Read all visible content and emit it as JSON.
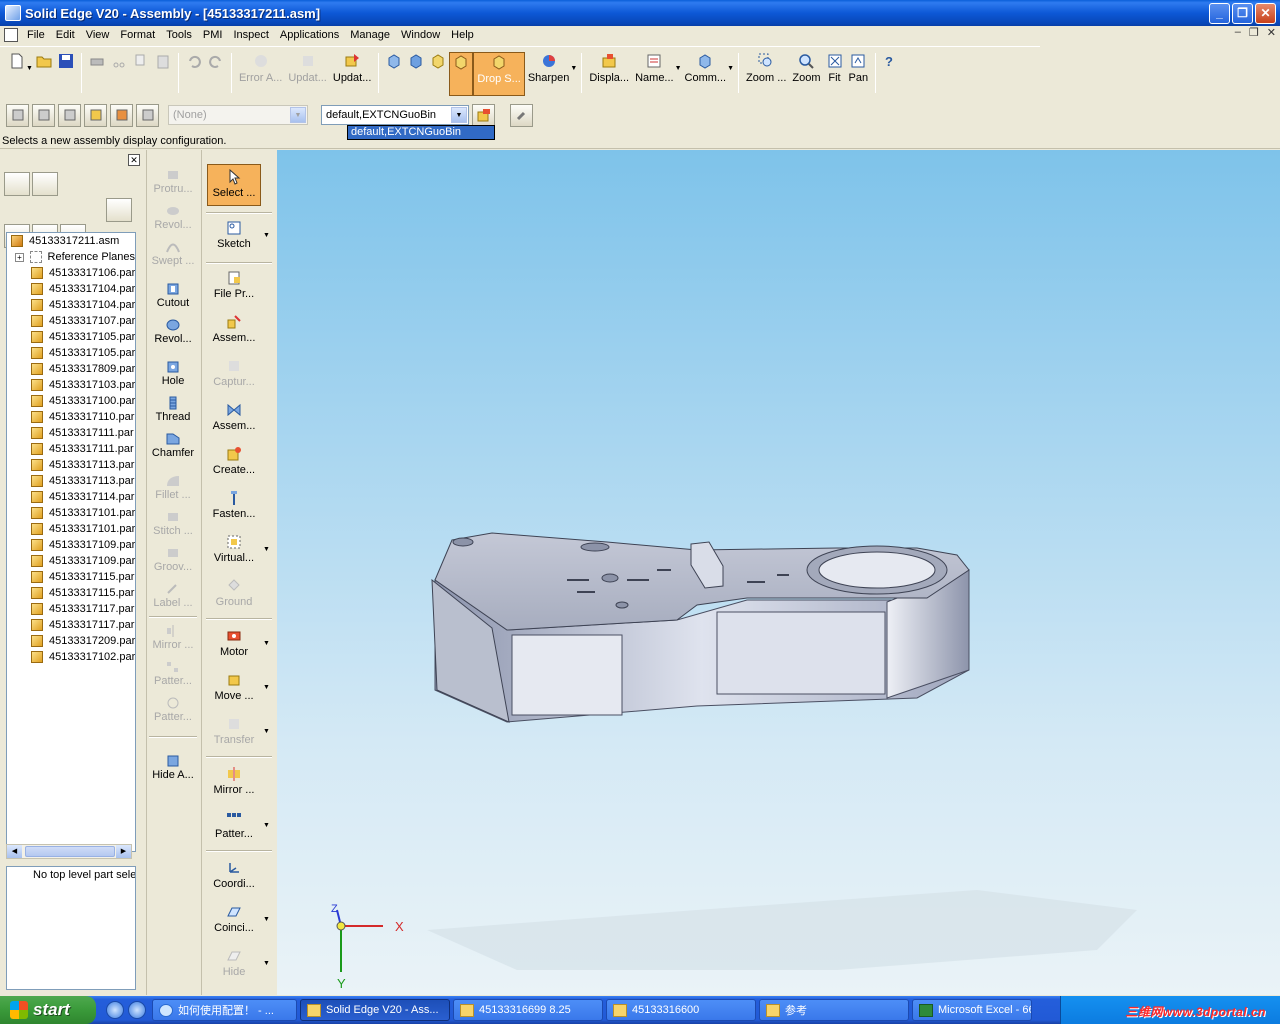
{
  "window": {
    "title": "Solid Edge V20 - Assembly - [45133317211.asm]"
  },
  "menu": [
    "File",
    "Edit",
    "View",
    "Format",
    "Tools",
    "PMI",
    "Inspect",
    "Applications",
    "Manage",
    "Window",
    "Help"
  ],
  "ribbon": {
    "error_assistant": "Error A...",
    "update_disabled": "Updat...",
    "update": "Updat...",
    "drop_shading": "Drop S...",
    "sharpen": "Sharpen",
    "display": "Displa...",
    "named_views": "Name...",
    "common_views": "Comm...",
    "zoom_area": "Zoom ...",
    "zoom": "Zoom",
    "fit": "Fit",
    "pan": "Pan"
  },
  "toolbar2": {
    "config_none": "(None)",
    "display_config": "default,EXTCNGuoBin",
    "dropdown_selected": "default,EXTCNGuoBin"
  },
  "prompt": "Selects a new assembly display configuration.",
  "tree": {
    "root": "45133317211.asm",
    "reference_planes": "Reference Planes",
    "parts": [
      "45133317106.par",
      "45133317104.par",
      "45133317104.par",
      "45133317107.par",
      "45133317105.par",
      "45133317105.par",
      "45133317809.par",
      "45133317103.par",
      "45133317100.par",
      "45133317110.par",
      "45133317111.par",
      "45133317111.par",
      "45133317113.par",
      "45133317113.par",
      "45133317114.par",
      "45133317101.par",
      "45133317101.par",
      "45133317109.par",
      "45133317109.par",
      "45133317115.par",
      "45133317115.par",
      "45133317117.par",
      "45133317117.par",
      "45133317209.par",
      "45133317102.par"
    ],
    "info": "No top level part selected"
  },
  "features": {
    "protrusion": "Protru...",
    "revolved_disabled": "Revol...",
    "swept": "Swept ...",
    "cutout": "Cutout",
    "revolved_cut": "Revol...",
    "hole": "Hole",
    "thread": "Thread",
    "chamfer": "Chamfer",
    "fillet": "Fillet ...",
    "stitch": "Stitch ...",
    "groove": "Groov...",
    "label": "Label ...",
    "mirror": "Mirror ...",
    "pattern1": "Patter...",
    "pattern2": "Patter...",
    "hide_all": "Hide A..."
  },
  "assembly_cmds": {
    "select": "Select ...",
    "sketch": "Sketch",
    "file_properties": "File Pr...",
    "assemble": "Assem...",
    "capture": "Captur...",
    "assembly_relationships": "Assem...",
    "create": "Create...",
    "fastener": "Fasten...",
    "virtual": "Virtual...",
    "ground": "Ground",
    "motor": "Motor",
    "move": "Move ...",
    "transfer": "Transfer",
    "mirror": "Mirror ...",
    "pattern": "Patter...",
    "coordinate": "Coordi...",
    "coincident": "Coinci...",
    "hide": "Hide"
  },
  "triad": {
    "x": "X",
    "y": "Y",
    "z": "Z"
  },
  "taskbar": {
    "start": "start",
    "tasks": [
      "如何使用配置！ - ...",
      "Solid Edge V20 - Ass...",
      "45133316699 8.25",
      "45133316600",
      "参考",
      "Microsoft Excel - 669..."
    ],
    "watermark": "三维网www.3dportal.cn"
  }
}
